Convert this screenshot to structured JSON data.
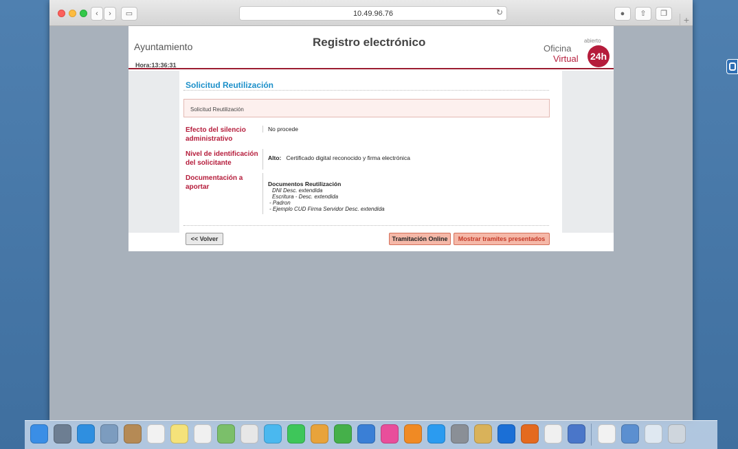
{
  "browser": {
    "url": "10.49.96.76"
  },
  "header": {
    "ayuntamiento": "Ayuntamiento",
    "hora": "Hora:13:36:31",
    "title": "Registro electrónico",
    "oficina": "Oficina",
    "virtual": "Virtual",
    "abierto": "abierto",
    "badge": "24h"
  },
  "section": {
    "title": "Solicitud Reutilización",
    "box_text": "Solicitud Reutilización"
  },
  "fields": {
    "silencio_label": "Efecto del silencio administrativo",
    "silencio_value": "No procede",
    "nivel_label": "Nivel de identificación del solicitante",
    "nivel_level": "Alto:",
    "nivel_value": "Certificado digital reconocido y firma electrónica",
    "doc_label": "Documentación a aportar",
    "doc_title": "Documentos Reutilización",
    "doc_items": [
      "DNI Desc. extendida",
      "Escritura - Desc. extendida",
      "- Padron",
      "- Ejemplo CUD Firma Servidor Desc. extendida"
    ]
  },
  "buttons": {
    "back": "<< Volver",
    "online": "Tramitación Online",
    "present": "Mostrar tramites presentados"
  },
  "dock_icons": [
    {
      "name": "finder-icon",
      "color": "#3a8ee6"
    },
    {
      "name": "launchpad-icon",
      "color": "#6d7e92"
    },
    {
      "name": "safari-icon",
      "color": "#2f8fe0"
    },
    {
      "name": "preview-icon",
      "color": "#7c9cbf"
    },
    {
      "name": "contacts-icon",
      "color": "#b58a55"
    },
    {
      "name": "calendar-icon",
      "color": "#f2f2f2"
    },
    {
      "name": "notes-icon",
      "color": "#f5e27a"
    },
    {
      "name": "reminders-icon",
      "color": "#f0f0f0"
    },
    {
      "name": "maps-icon",
      "color": "#7bbf6a"
    },
    {
      "name": "photos-icon",
      "color": "#e7e7e7"
    },
    {
      "name": "messages-icon",
      "color": "#4ab8ef"
    },
    {
      "name": "facetime-icon",
      "color": "#3ec65a"
    },
    {
      "name": "pages-icon",
      "color": "#e8a33b"
    },
    {
      "name": "numbers-icon",
      "color": "#45b04a"
    },
    {
      "name": "keynote-icon",
      "color": "#3a7fd6"
    },
    {
      "name": "itunes-icon",
      "color": "#e94e9b"
    },
    {
      "name": "ibooks-icon",
      "color": "#f08a24"
    },
    {
      "name": "appstore-icon",
      "color": "#2b9bf0"
    },
    {
      "name": "system-preferences-icon",
      "color": "#8a8f96"
    },
    {
      "name": "keychain-icon",
      "color": "#d9b25a"
    },
    {
      "name": "teamviewer-icon",
      "color": "#1b6fd6"
    },
    {
      "name": "firefox-icon",
      "color": "#e46a1f"
    },
    {
      "name": "java-icon",
      "color": "#f0f0f0"
    },
    {
      "name": "autofirma-icon",
      "color": "#4a76c9"
    },
    {
      "name": "pdf-document-icon",
      "color": "#f2f2f2"
    },
    {
      "name": "downloads-icon",
      "color": "#5b8fd0"
    },
    {
      "name": "stack-folder-icon",
      "color": "#dfe8f1"
    },
    {
      "name": "trash-icon",
      "color": "#cfd6dd"
    }
  ]
}
